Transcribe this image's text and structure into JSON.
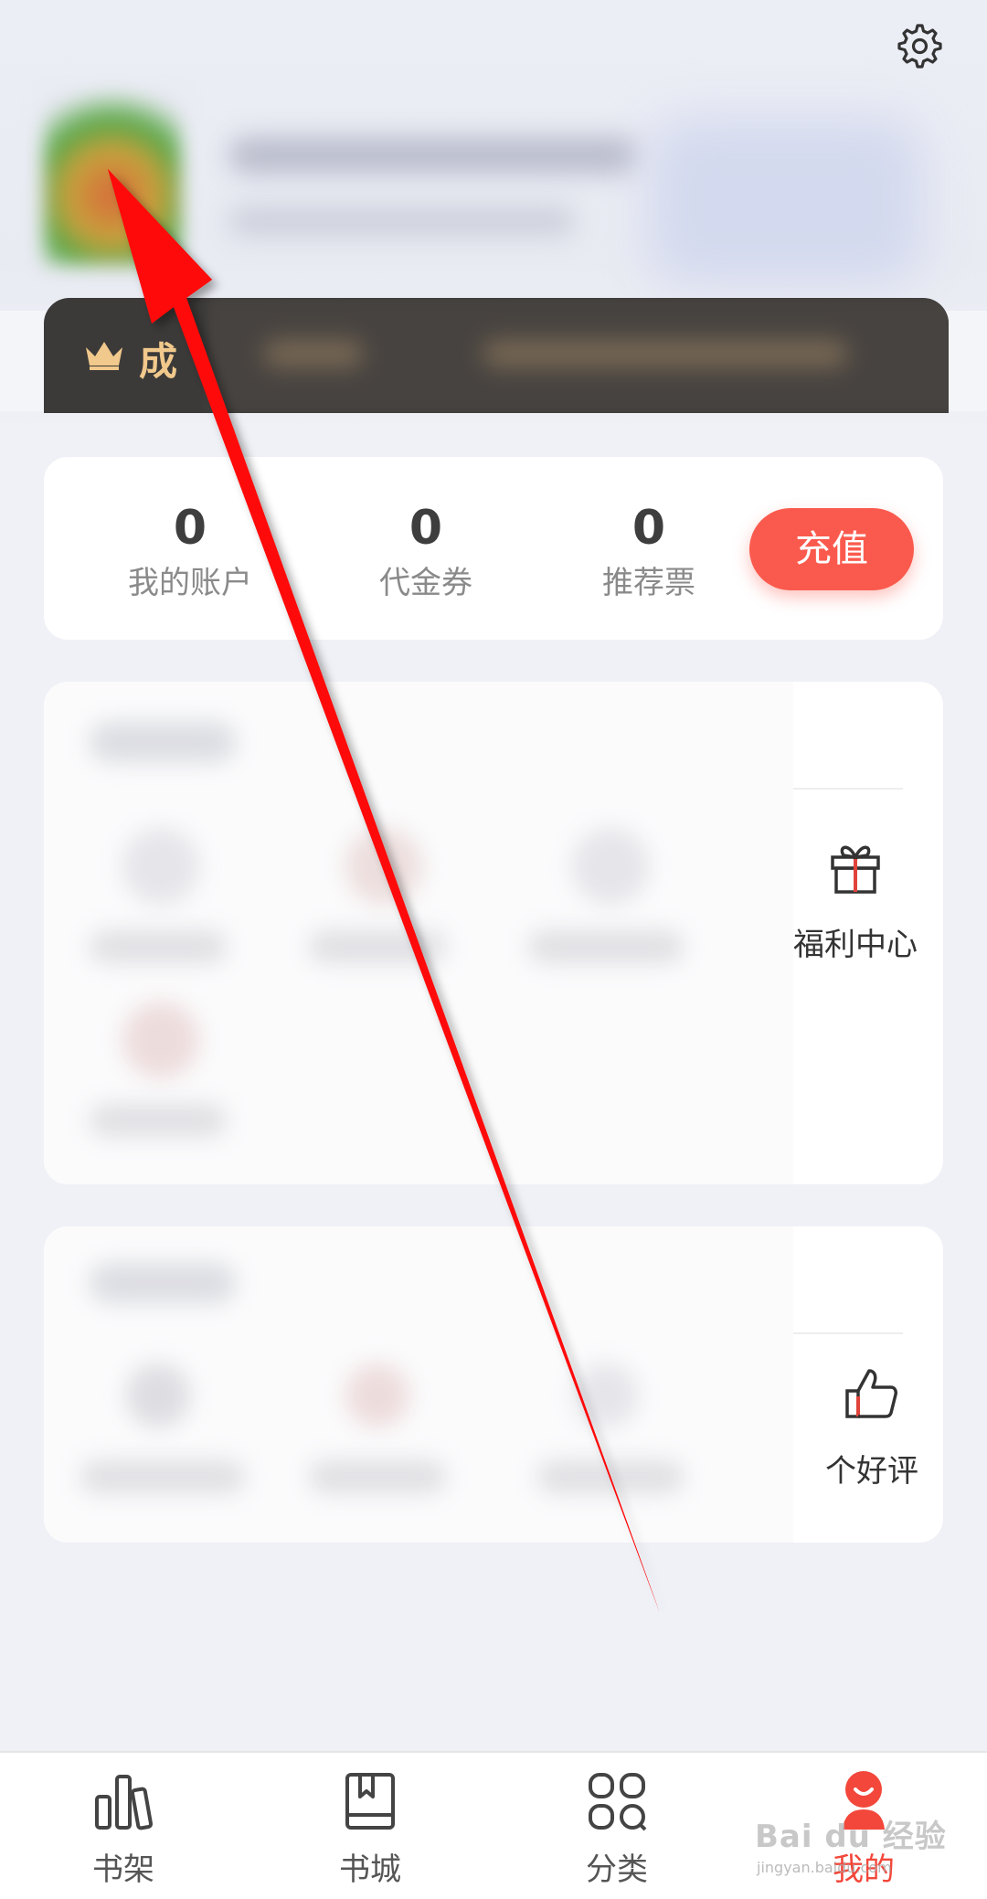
{
  "header": {
    "settings_icon": "gear-icon",
    "vip_label_visible": "成"
  },
  "account": {
    "stats": [
      {
        "value": "0",
        "label": "我的账户"
      },
      {
        "value": "0",
        "label": "代金券"
      },
      {
        "value": "0",
        "label": "推荐票"
      }
    ],
    "recharge_label": "充值"
  },
  "cards": {
    "welfare": {
      "label": "福利中心",
      "icon": "gift-icon"
    },
    "review": {
      "label": "个好评",
      "icon": "thumbs-up-icon"
    }
  },
  "bottom_nav": {
    "items": [
      {
        "label": "书架",
        "icon": "bar-chart-icon"
      },
      {
        "label": "书城",
        "icon": "book-icon"
      },
      {
        "label": "分类",
        "icon": "grid-icon"
      },
      {
        "label": "我的",
        "icon": "user-icon"
      }
    ],
    "active": "我的"
  },
  "watermark": {
    "text": "Bai du 经验",
    "sub": "jingyan.baidu.com"
  },
  "colors": {
    "accent": "#fa5a4d",
    "nav_active": "#f2473a",
    "vip_bg": "#3b3a39",
    "vip_text": "#f1c98c"
  }
}
